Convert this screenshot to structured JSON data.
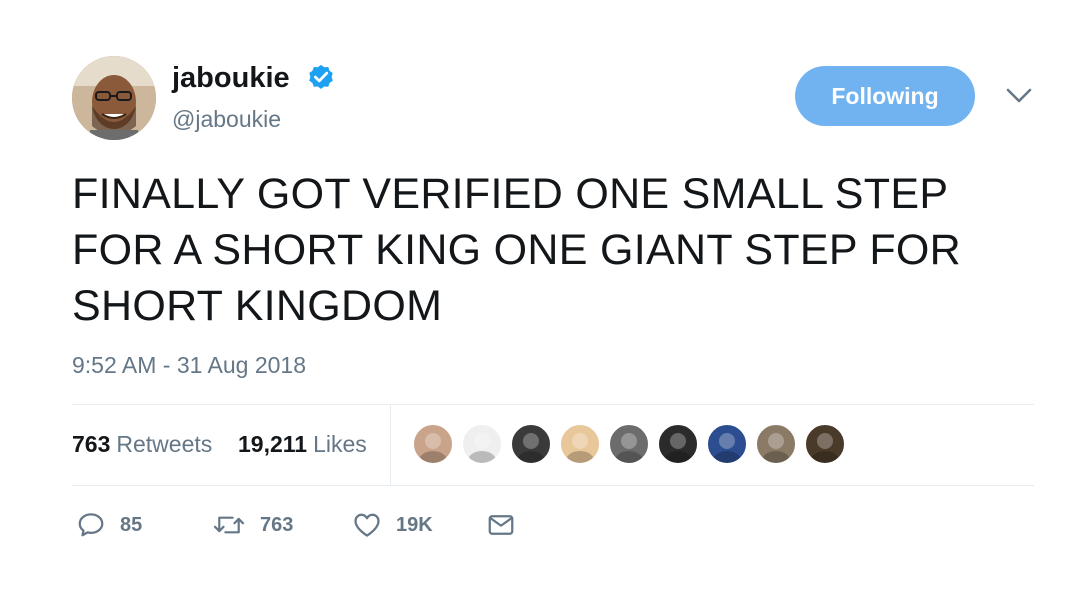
{
  "user": {
    "display_name": "jaboukie",
    "handle": "@jaboukie",
    "verified_icon": "verified-badge-icon"
  },
  "follow_button": {
    "label": "Following"
  },
  "tweet": {
    "text": "FINALLY GOT VERIFIED ONE SMALL STEP FOR A SHORT KING ONE GIANT STEP FOR SHORT KINGDOM",
    "timestamp": "9:52 AM - 31 Aug 2018"
  },
  "stats": {
    "retweets_count": "763",
    "retweets_label": "Retweets",
    "likes_count": "19,211",
    "likes_label": "Likes"
  },
  "likers": [
    {
      "color": "#c9a48a"
    },
    {
      "color": "#efefef"
    },
    {
      "color": "#3a3a3a"
    },
    {
      "color": "#e8c79a"
    },
    {
      "color": "#6c6c6c"
    },
    {
      "color": "#2b2b2b"
    },
    {
      "color": "#2c4d8f"
    },
    {
      "color": "#8a7a66"
    },
    {
      "color": "#4a3a2a"
    }
  ],
  "actions": {
    "reply_count": "85",
    "retweet_count": "763",
    "like_count": "19K"
  },
  "colors": {
    "accent": "#71b3f0",
    "verified": "#1da1f2",
    "secondary_text": "#657786",
    "divider": "#e6ecf0"
  }
}
